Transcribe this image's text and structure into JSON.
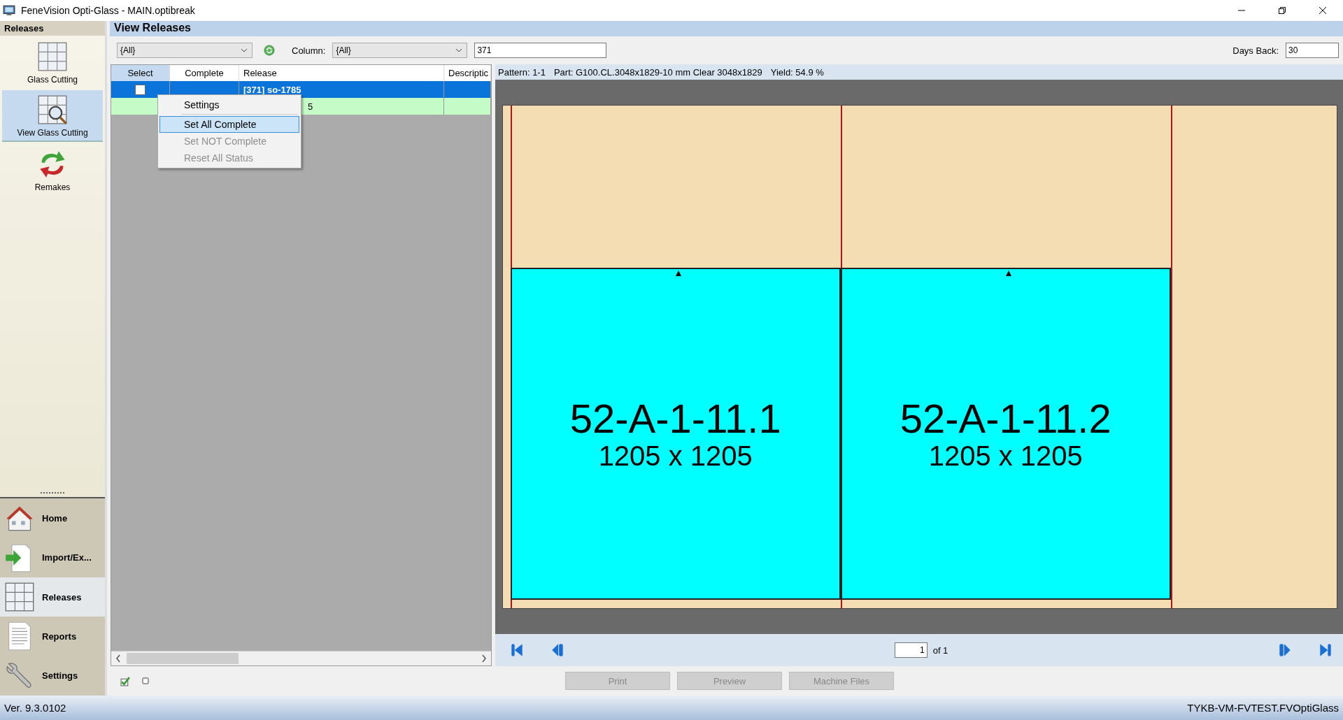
{
  "window": {
    "title": "FeneVision Opti-Glass - MAIN.optibreak"
  },
  "sidebar": {
    "title": "Releases",
    "items": [
      {
        "label": "Glass Cutting",
        "kind": "grid",
        "selected": false
      },
      {
        "label": "View Glass Cutting",
        "kind": "grid-search",
        "selected": true
      },
      {
        "label": "Remakes",
        "kind": "recycle",
        "selected": false
      }
    ]
  },
  "nav": [
    {
      "label": "Home",
      "kind": "house",
      "selected": false
    },
    {
      "label": "Import/Ex...",
      "kind": "import",
      "selected": false
    },
    {
      "label": "Releases",
      "kind": "grid",
      "selected": true
    },
    {
      "label": "Reports",
      "kind": "report",
      "selected": false
    },
    {
      "label": "Settings",
      "kind": "wrench",
      "selected": false
    }
  ],
  "page_title": "View Releases",
  "toolbar": {
    "filter": "{All}",
    "column_label": "Column:",
    "column": "{All}",
    "search": "371",
    "days_back_label": "Days Back:",
    "days_back": "30"
  },
  "table": {
    "columns": [
      {
        "label": "Select",
        "selected": true
      },
      {
        "label": "Complete",
        "selected": false
      },
      {
        "label": "Release",
        "selected": false
      },
      {
        "label": "Descriptic",
        "selected": false
      }
    ],
    "rows": [
      {
        "checked": false,
        "release": "[371] so-1785",
        "selected": true,
        "complete": false
      },
      {
        "release": "5",
        "selected": false,
        "complete": true
      }
    ]
  },
  "context_menu": [
    {
      "label": "Settings",
      "selected": false,
      "disabled": false,
      "separator_after": true
    },
    {
      "label": "Set All Complete",
      "selected": true,
      "disabled": false,
      "separator_after": false
    },
    {
      "label": "Set NOT Complete",
      "selected": false,
      "disabled": true,
      "separator_after": false
    },
    {
      "label": "Reset All Status",
      "selected": false,
      "disabled": true,
      "separator_after": false
    }
  ],
  "preview": {
    "pattern": "Pattern: 1-1",
    "part": "Part: G100.CL.3048x1829-10 mm Clear 3048x1829",
    "yield": "Yield: 54.9 %",
    "pieces": [
      {
        "label": "52-A-1-11.1",
        "size": "1205 x 1205"
      },
      {
        "label": "52-A-1-11.2",
        "size": "1205 x 1205"
      }
    ],
    "page": "1",
    "page_of": "of 1"
  },
  "buttons": [
    {
      "label": "Print",
      "disabled": true
    },
    {
      "label": "Preview",
      "disabled": true
    },
    {
      "label": "Machine Files",
      "disabled": true
    }
  ],
  "status_bar": {
    "version": "Ver. 9.3.0102",
    "server": "TYKB-VM-FVTEST.FVOptiGlass"
  }
}
